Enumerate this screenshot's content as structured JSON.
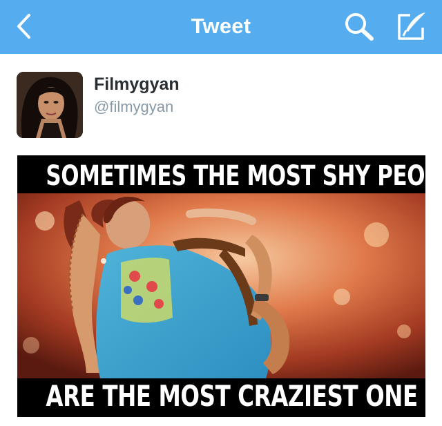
{
  "navbar": {
    "title": "Tweet",
    "back_icon": "chevron-left-icon",
    "search_icon": "search-icon",
    "compose_icon": "compose-icon",
    "background": "#55acee"
  },
  "tweet": {
    "display_name": "Filmygyan",
    "handle": "@filmygyan",
    "meme": {
      "caption_top": "SOMETIMES THE MOST SHY PEOPLE",
      "caption_bottom": "ARE THE MOST CRAZIEST ONE"
    }
  }
}
